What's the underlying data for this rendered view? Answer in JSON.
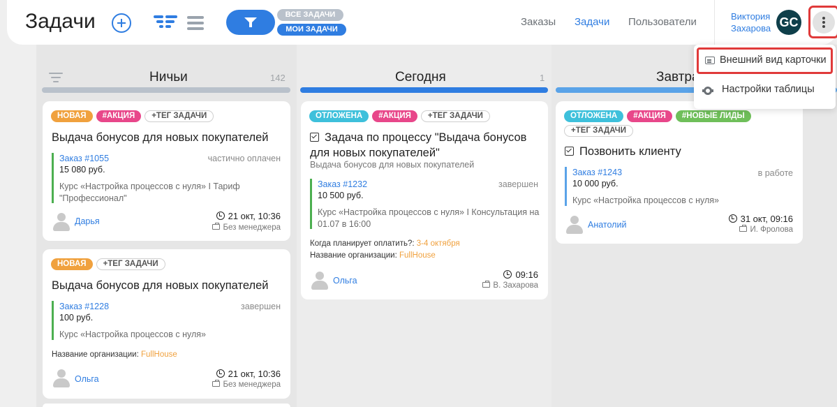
{
  "header": {
    "title": "Задачи",
    "filter_all": "ВСЕ ЗАДАЧИ",
    "filter_mine": "МОИ ЗАДАЧИ",
    "nav": [
      "Заказы",
      "Задачи",
      "Пользователи"
    ],
    "user_first": "Виктория",
    "user_last": "Захарова",
    "avatar_initials": "GC"
  },
  "menu": {
    "card_view": "Внешний вид карточки",
    "table_settings": "Настройки таблицы"
  },
  "columns": [
    {
      "title": "Ничьи",
      "count": "142",
      "bar_color": "#b9c1cb"
    },
    {
      "title": "Сегодня",
      "count": "1",
      "bar_color": "#2f7de1"
    },
    {
      "title": "Завтра",
      "count": "",
      "bar_color": "#5aa3e8"
    }
  ],
  "cards": {
    "c1": {
      "tags": [
        "НОВАЯ",
        "#АКЦИЯ",
        "+ТЕГ ЗАДАЧИ"
      ],
      "title": "Выдача бонусов для новых покупателей",
      "order_link": "Заказ #1055",
      "order_status": "частично оплачен",
      "amount": "15 080 руб.",
      "desc": "Курс «Настройка процессов с нуля» I Тариф \"Профессионал\"",
      "person": "Дарья",
      "due": "21 окт, 10:36",
      "manager": "Без менеджера"
    },
    "c2": {
      "tags": [
        "НОВАЯ",
        "+ТЕГ ЗАДАЧИ"
      ],
      "title": "Выдача бонусов для новых покупателей",
      "order_link": "Заказ #1228",
      "order_status": "завершен",
      "amount": "100 руб.",
      "desc": "Курс «Настройка процессов с нуля»",
      "field_label": "Название организации:",
      "field_value": "FullHouse",
      "person": "Ольга",
      "due": "21 окт, 10:36",
      "manager": "Без менеджера"
    },
    "c3": {
      "tags": [
        "ОТЛОЖЕНА",
        "#АКЦИЯ",
        "+ТЕГ ЗАДАЧИ"
      ],
      "title_line1": "Задача по процессу \"Выдача бонусов",
      "title_line2": "для новых покупателей\"",
      "subtitle": "Выдача бонусов для новых покупателей",
      "order_link": "Заказ #1232",
      "order_status": "завершен",
      "amount": "10 500 руб.",
      "desc": "Курс «Настройка процессов с нуля» I Консультация на 01.07 в 16:00",
      "field1_label": "Когда планирует оплатить?:",
      "field1_value": "3-4 октября",
      "field2_label": "Название организации:",
      "field2_value": "FullHouse",
      "person": "Ольга",
      "due": "09:16",
      "manager": "В. Захарова"
    },
    "c4": {
      "tags": [
        "ОТЛОЖЕНА",
        "#АКЦИЯ",
        "#НОВЫЕ ЛИДЫ",
        "+ТЕГ ЗАДАЧИ"
      ],
      "title": "Позвонить клиенту",
      "order_link": "Заказ #1243",
      "order_status": "в работе",
      "amount": "10 000 руб.",
      "desc": "Курс «Настройка процессов с нуля»",
      "person": "Анатолий",
      "due": "31 окт, 09:16",
      "manager": "И. Фролова"
    }
  },
  "colors": {
    "accent": "#2f7de1",
    "tag_new": "#f0a13e",
    "tag_promo": "#e8478a",
    "tag_postponed": "#3ec0db",
    "tag_leads": "#6fbf5a",
    "highlight": "#e03a3a"
  }
}
